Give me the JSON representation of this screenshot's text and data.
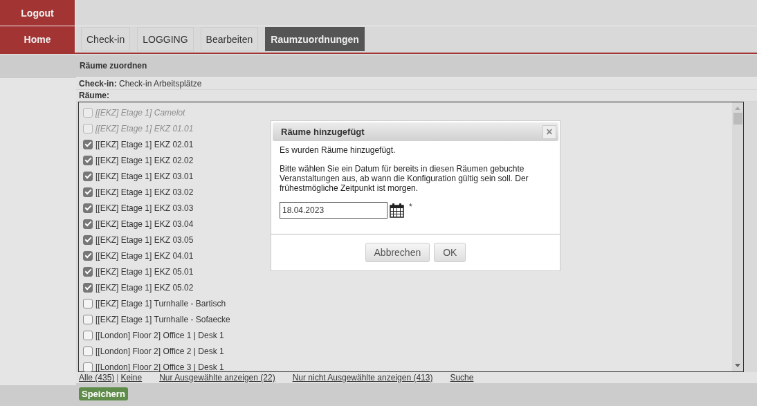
{
  "sidebar": {
    "buttons": [
      "Logout",
      "Home"
    ]
  },
  "tabs": [
    {
      "label": "Check-in",
      "selected": false
    },
    {
      "label": "LOGGING",
      "selected": false
    },
    {
      "label": "Bearbeiten",
      "selected": false
    },
    {
      "label": "Raumzuordnungen",
      "selected": true
    }
  ],
  "section_title": "Räume zuordnen",
  "checkin": {
    "label": "Check-in:",
    "value": "Check-in Arbeitsplätze"
  },
  "rooms_label": "Räume:",
  "rooms": [
    {
      "name": "[[EKZ] Etage 1] Camelot",
      "checked": false,
      "disabled": true
    },
    {
      "name": "[[EKZ] Etage 1] EKZ 01.01",
      "checked": false,
      "disabled": true
    },
    {
      "name": "[[EKZ] Etage 1] EKZ 02.01",
      "checked": true,
      "disabled": false
    },
    {
      "name": "[[EKZ] Etage 1] EKZ 02.02",
      "checked": true,
      "disabled": false
    },
    {
      "name": "[[EKZ] Etage 1] EKZ 03.01",
      "checked": true,
      "disabled": false
    },
    {
      "name": "[[EKZ] Etage 1] EKZ 03.02",
      "checked": true,
      "disabled": false
    },
    {
      "name": "[[EKZ] Etage 1] EKZ 03.03",
      "checked": true,
      "disabled": false
    },
    {
      "name": "[[EKZ] Etage 1] EKZ 03.04",
      "checked": true,
      "disabled": false
    },
    {
      "name": "[[EKZ] Etage 1] EKZ 03.05",
      "checked": true,
      "disabled": false
    },
    {
      "name": "[[EKZ] Etage 1] EKZ 04.01",
      "checked": true,
      "disabled": false
    },
    {
      "name": "[[EKZ] Etage 1] EKZ 05.01",
      "checked": true,
      "disabled": false
    },
    {
      "name": "[[EKZ] Etage 1] EKZ 05.02",
      "checked": true,
      "disabled": false
    },
    {
      "name": "[[EKZ] Etage 1] Turnhalle - Bartisch",
      "checked": false,
      "disabled": false
    },
    {
      "name": "[[EKZ] Etage 1] Turnhalle - Sofaecke",
      "checked": false,
      "disabled": false
    },
    {
      "name": "[[London] Floor 2] Office 1 | Desk 1",
      "checked": false,
      "disabled": false
    },
    {
      "name": "[[London] Floor 2] Office 2 | Desk 1",
      "checked": false,
      "disabled": false
    },
    {
      "name": "[[London] Floor 2] Office 3 | Desk 1",
      "checked": false,
      "disabled": false
    }
  ],
  "list_links": {
    "all": "Alle (435)",
    "separator": "|",
    "none": "Keine",
    "only_selected": "Nur Ausgewählte anzeigen (22)",
    "only_unselected": "Nur nicht Ausgewählte anzeigen (413)",
    "search": "Suche"
  },
  "save_button": "Speichern",
  "dialog": {
    "title": "Räume hinzugefügt",
    "close": "×",
    "message": "Es wurden Räume hinzugefügt.",
    "instructions": "Bitte wählen Sie ein Datum für bereits in diesen Räumen gebuchte Veranstaltungen aus, ab wann die Konfiguration gültig sein soll. Der frühestmögliche Zeitpunkt ist morgen.",
    "date": "18.04.2023",
    "required_mark": "*",
    "buttons": [
      "Abbrechen",
      "OK"
    ]
  }
}
